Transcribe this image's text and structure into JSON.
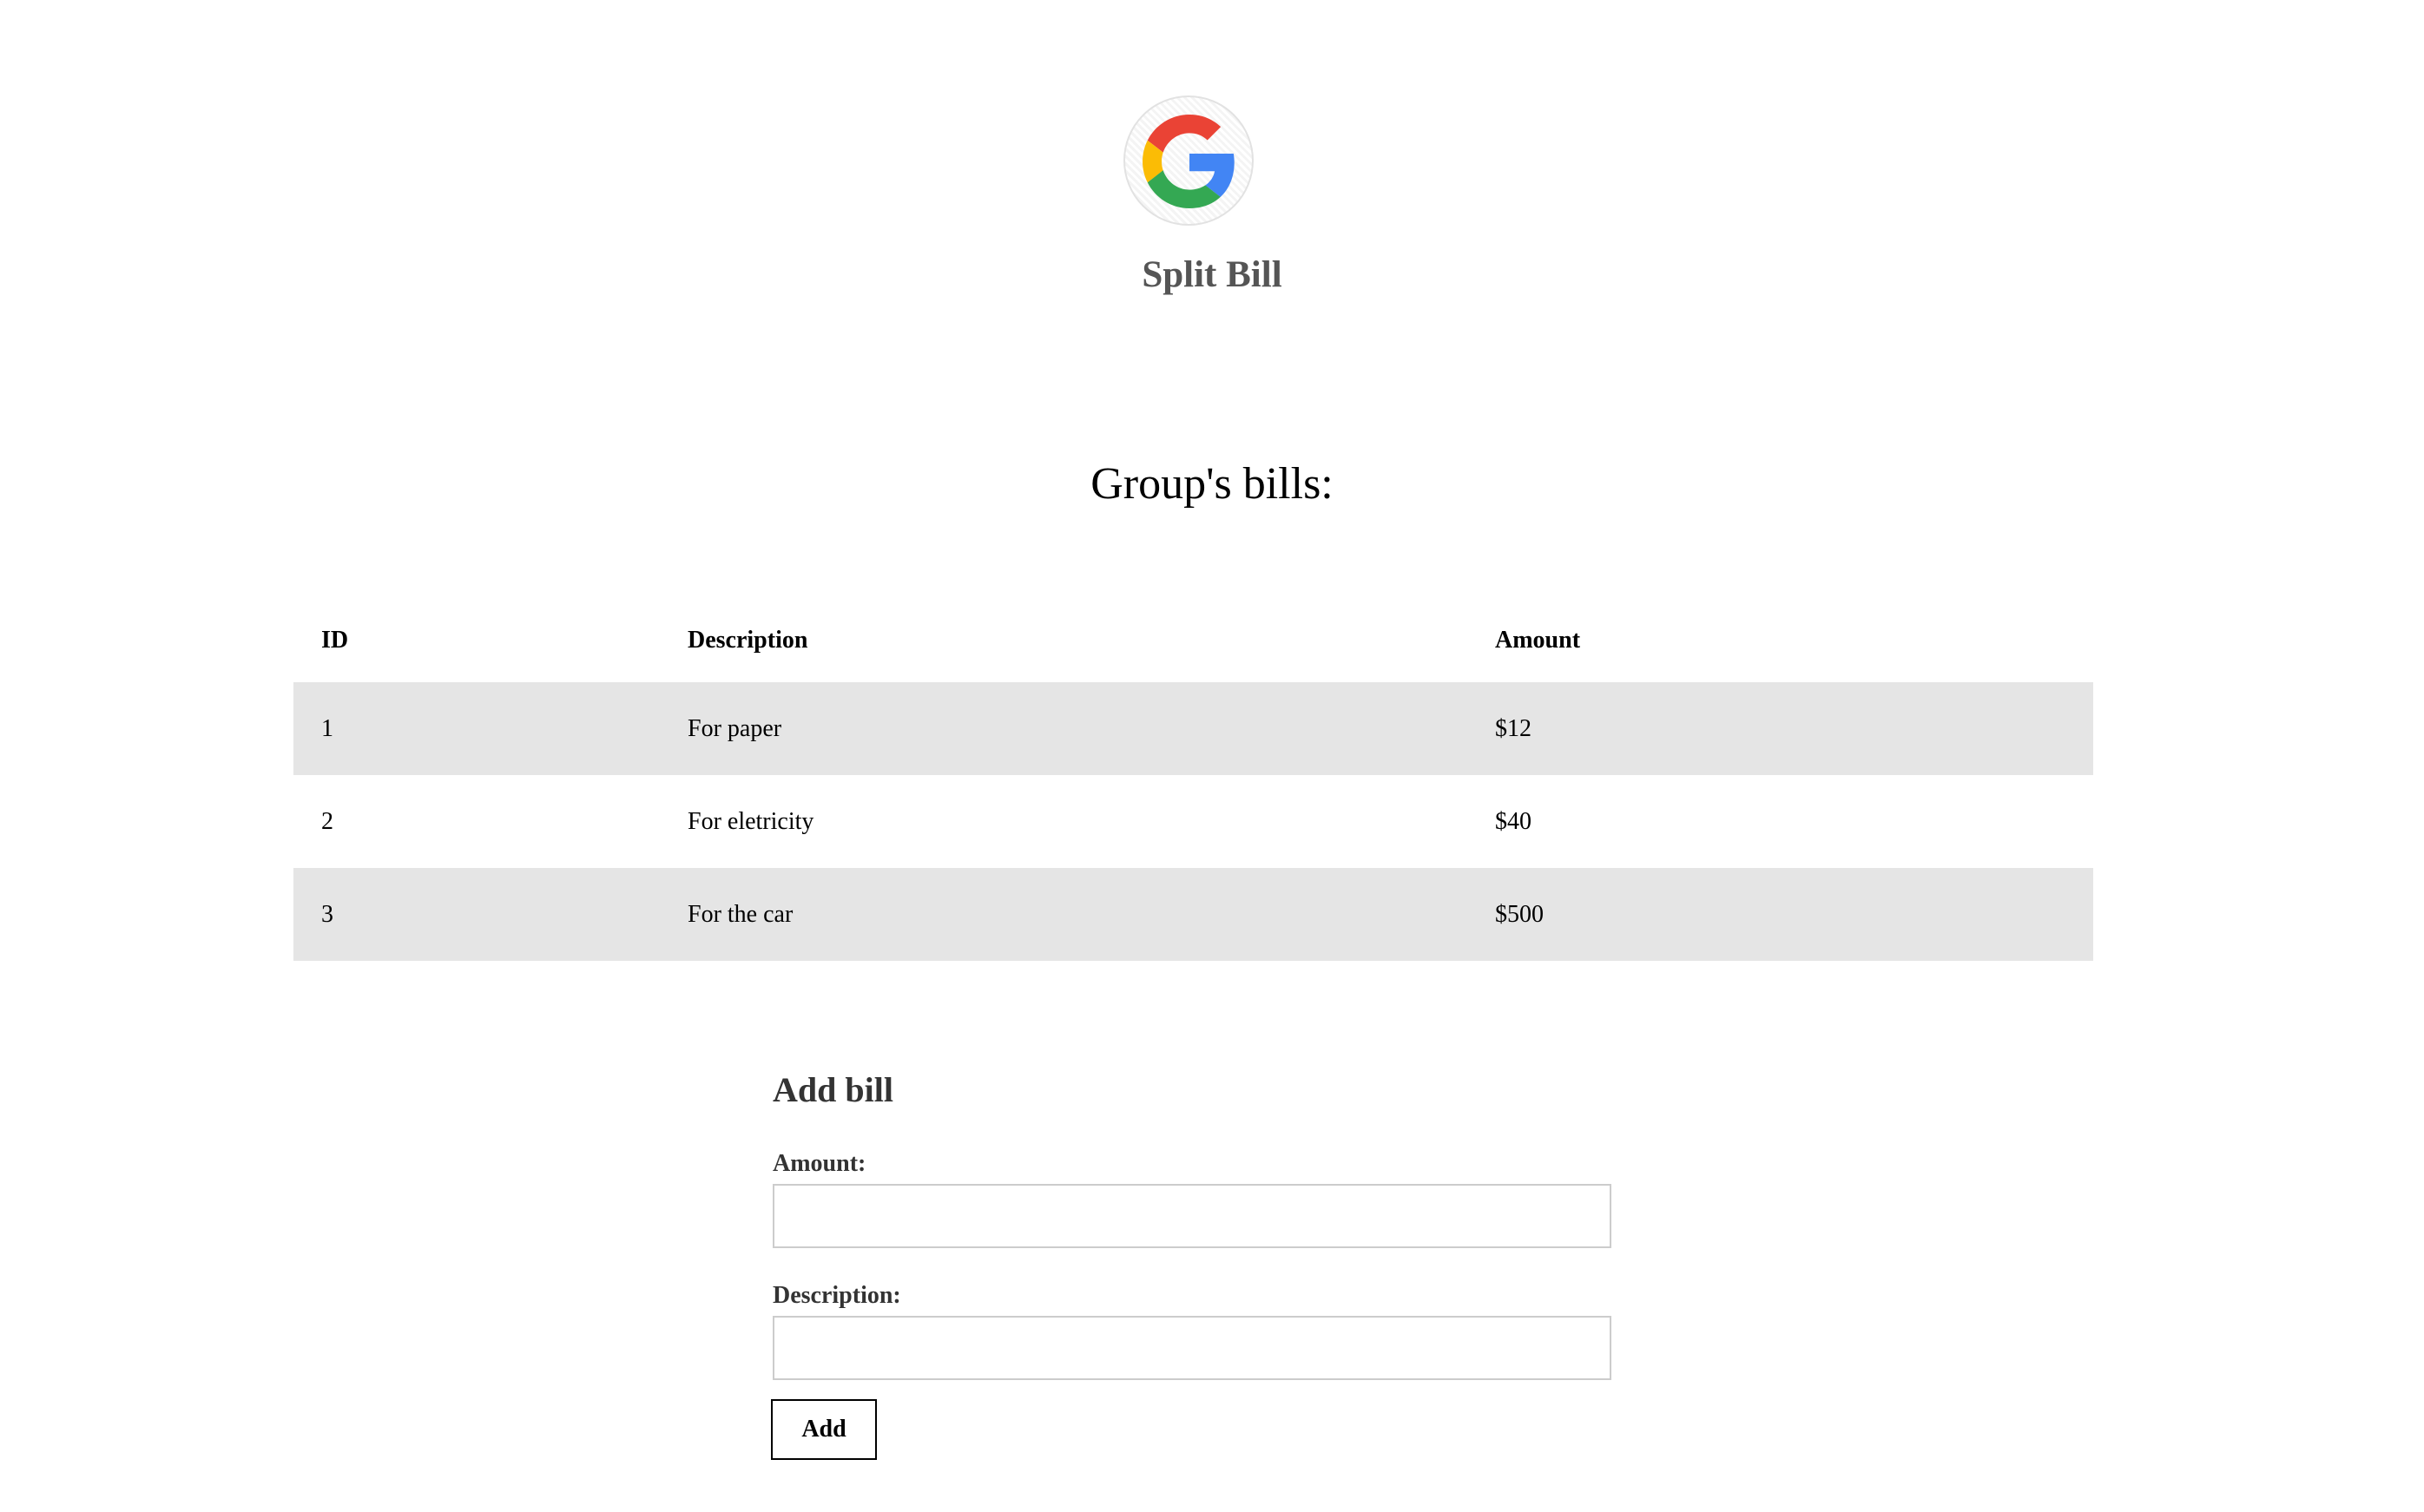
{
  "header": {
    "logo_icon": "google-g-icon",
    "app_title": "Split Bill"
  },
  "bills_section": {
    "title": "Group's bills:",
    "columns": [
      "ID",
      "Description",
      "Amount"
    ],
    "rows": [
      {
        "id": "1",
        "description": "For paper",
        "amount": "$12"
      },
      {
        "id": "2",
        "description": "For eletricity",
        "amount": "$40"
      },
      {
        "id": "3",
        "description": "For the car",
        "amount": "$500"
      }
    ]
  },
  "add_bill_form": {
    "title": "Add bill",
    "amount_label": "Amount:",
    "amount_value": "",
    "description_label": "Description:",
    "description_value": "",
    "submit_label": "Add"
  },
  "colors": {
    "google_red": "#EA4335",
    "google_yellow": "#FBBC05",
    "google_green": "#34A853",
    "google_blue": "#4285F4",
    "row_stripe": "#E5E5E5",
    "title_gray": "#555555"
  }
}
